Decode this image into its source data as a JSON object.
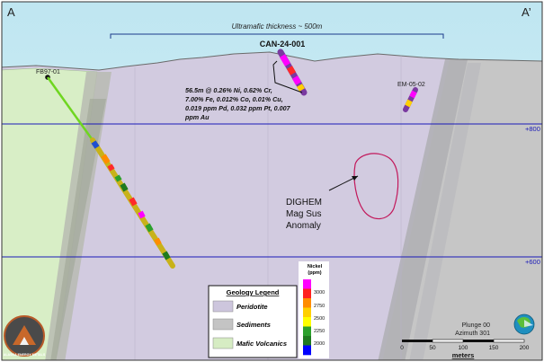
{
  "section": {
    "left_label": "A",
    "right_label": "A’",
    "thickness_label": "Ultramafic thickness ~ 500m",
    "main_hole": "CAN-24-001",
    "hole_fb": "FB97-01",
    "hole_em": "EM-05-02",
    "intercept_lines": [
      "56.5m @ 0.26% Ni, 0.62% Cr,",
      "7.00% Fe, 0.012% Co, 0.01% Cu,",
      "0.019 ppm Pd, 0.032 ppm Pt, 0.007",
      "ppm Au"
    ],
    "elev_800": "+800",
    "elev_600": "+600",
    "anomaly_lines": [
      "DIGHEM",
      "Mag Sus",
      "Anomaly"
    ]
  },
  "legend": {
    "title": "Geology Legend",
    "items": [
      {
        "label": "Peridotite",
        "color": "#cdc6dd"
      },
      {
        "label": "Sediments",
        "color": "#c4c4c4"
      },
      {
        "label": "Mafic Volcanics",
        "color": "#d6ecc3"
      }
    ]
  },
  "nickel_scale": {
    "title_line1": "Nickel",
    "title_line2": "(ppm)",
    "ticks": [
      "3000",
      "2750",
      "2500",
      "2250",
      "2000"
    ],
    "colors": [
      "#ff00ff",
      "#ff2020",
      "#ff8c00",
      "#ffd000",
      "#ffff00",
      "#2ca02c",
      "#1f7a1f",
      "#0000ff"
    ]
  },
  "orientation": {
    "plunge": "Plunge 00",
    "azimuth": "Azimuth 301"
  },
  "scale_bar": {
    "ticks": [
      "0",
      "50",
      "100",
      "150",
      "200"
    ],
    "unit": "meters"
  },
  "logo": {
    "text": "ALASKA ENERGY METALS"
  }
}
